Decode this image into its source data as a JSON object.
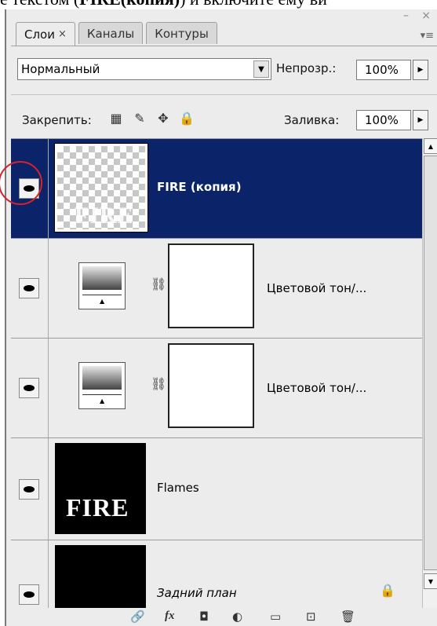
{
  "doc_text": {
    "prefix": "е текстом (",
    "bold": "FIRE(копия)",
    "suffix": ") и включите ему ви"
  },
  "window_controls": "– ×",
  "tabs": [
    {
      "label": "Слои",
      "close": "×"
    },
    {
      "label": "Каналы"
    },
    {
      "label": "Контуры"
    }
  ],
  "panel_menu": "▾≡",
  "blend_mode": "Нормальный",
  "opacity": {
    "label": "Непрозр.:",
    "value": "100%"
  },
  "lock": {
    "label": "Закрепить:"
  },
  "fill": {
    "label": "Заливка:",
    "value": "100%"
  },
  "layers": [
    {
      "name": "FIRE (копия)",
      "selected": true,
      "thumb_text": "FIRE"
    },
    {
      "name": "Цветовой тон/..."
    },
    {
      "name": "Цветовой тон/..."
    },
    {
      "name": "Flames",
      "thumb_text": "FIRE"
    },
    {
      "name": "Задний план",
      "locked": true
    }
  ],
  "icons": {
    "eye": "eye-icon",
    "lock_transparent": "▦",
    "lock_brush": "✎",
    "lock_move": "✥",
    "lock_all": "🔒",
    "chain": "⛓",
    "footer": [
      "🔗",
      "fx",
      "◘",
      "◐",
      "▭",
      "⊡",
      "🗑"
    ]
  },
  "colors": {
    "selected": "#0b2469",
    "highlight_circle": "#d8212b"
  }
}
